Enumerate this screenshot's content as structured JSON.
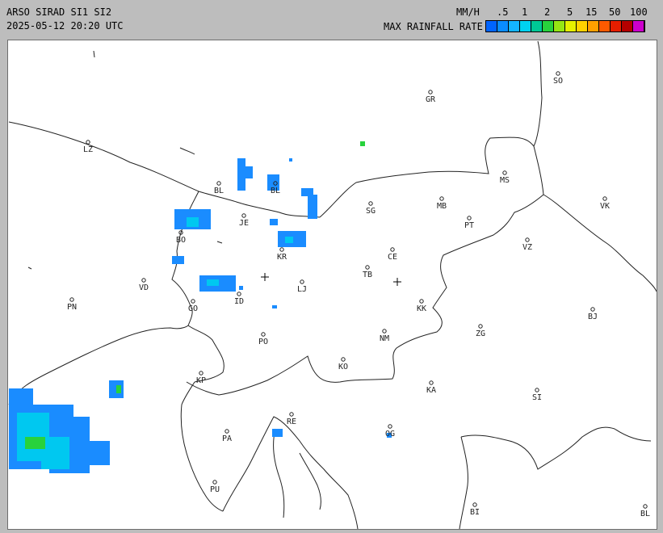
{
  "header": {
    "title": "ARSO SIRAD SI1 SI2",
    "timestamp": "2025-05-12 20:20 UTC",
    "units": "MM/H",
    "rate_label": "MAX RAINFALL RATE"
  },
  "legend": {
    "ticks": [
      ".5",
      "1",
      "2",
      "5",
      "15",
      "50",
      "100"
    ],
    "colors": [
      "#0064ff",
      "#0a8cff",
      "#14b4ff",
      "#00d2f0",
      "#00c896",
      "#28d23c",
      "#96e614",
      "#e6f000",
      "#ffd200",
      "#ffa000",
      "#ff5a00",
      "#e61e00",
      "#b40000",
      "#cc00cc"
    ]
  },
  "map": {
    "cities": [
      {
        "code": "SO"
      },
      {
        "code": "GR"
      },
      {
        "code": "LZ"
      },
      {
        "code": "BL"
      },
      {
        "code": "BL"
      },
      {
        "code": "MB"
      },
      {
        "code": "MS"
      },
      {
        "code": "VK"
      },
      {
        "code": "JE"
      },
      {
        "code": "SG"
      },
      {
        "code": "PT"
      },
      {
        "code": "BO"
      },
      {
        "code": "KR"
      },
      {
        "code": "CE"
      },
      {
        "code": "VZ"
      },
      {
        "code": "VD"
      },
      {
        "code": "TB"
      },
      {
        "code": "LJ"
      },
      {
        "code": "ID"
      },
      {
        "code": "PN"
      },
      {
        "code": "GO"
      },
      {
        "code": "KK"
      },
      {
        "code": "BJ"
      },
      {
        "code": "ZG"
      },
      {
        "code": "NM"
      },
      {
        "code": "PO"
      },
      {
        "code": "KO"
      },
      {
        "code": "KP"
      },
      {
        "code": "KA"
      },
      {
        "code": "SI"
      },
      {
        "code": "RE"
      },
      {
        "code": "PA"
      },
      {
        "code": "OG"
      },
      {
        "code": "PU"
      },
      {
        "code": "BI"
      },
      {
        "code": "BL"
      }
    ],
    "radar_sites": [
      "Lisca radar",
      "Pasja ravan radar"
    ]
  }
}
